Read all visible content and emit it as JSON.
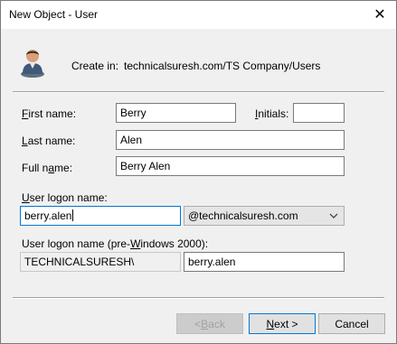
{
  "window": {
    "title": "New Object - User",
    "close_glyph": "✕"
  },
  "header": {
    "icon": "user-icon",
    "create_in_label": "Create in:",
    "create_in_value": "technicalsuresh.com/TS Company/Users"
  },
  "form": {
    "first_name": {
      "label_hotkey": "F",
      "label_rest": "irst name:",
      "value": "Berry"
    },
    "initials": {
      "label_hotkey": "I",
      "label_rest": "nitials:",
      "value": ""
    },
    "last_name": {
      "label_hotkey": "L",
      "label_rest": "ast name:",
      "value": "Alen"
    },
    "full_name": {
      "label_pre": "Full n",
      "label_hotkey": "a",
      "label_rest": "me:",
      "value": "Berry Alen"
    },
    "logon_name": {
      "label_hotkey": "U",
      "label_rest": "ser logon name:",
      "value": "berry.alen"
    },
    "domain_select": {
      "value": "@technicalsuresh.com"
    },
    "pre2000": {
      "label_pre": "User logon name (pre-",
      "label_hotkey": "W",
      "label_rest": "indows 2000):",
      "domain": "TECHNICALSURESH\\",
      "value": "berry.alen"
    }
  },
  "buttons": {
    "back": {
      "prefix": "< ",
      "hotkey": "B",
      "rest": "ack"
    },
    "next": {
      "hotkey": "N",
      "rest": "ext >"
    },
    "cancel": {
      "label": "Cancel"
    }
  }
}
